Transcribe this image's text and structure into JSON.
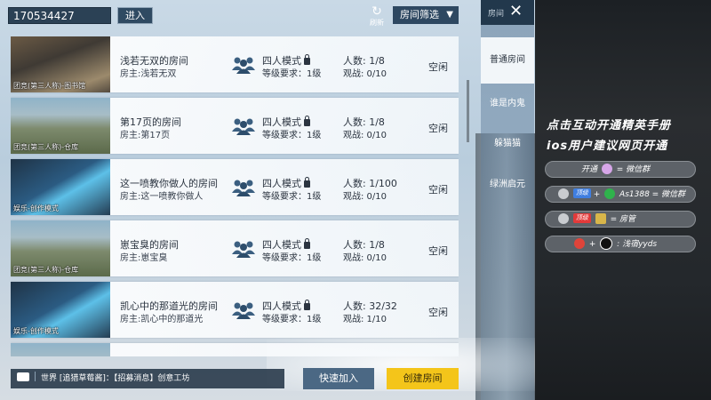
{
  "top_bar": {
    "room_id_value": "170534427",
    "enter_label": "进入",
    "refresh_label": "刷新",
    "filter_label": "房间筛选"
  },
  "rooms": [
    {
      "map_label": "团竞(第三人称)-图书馆",
      "name": "浅若无双的房间",
      "owner": "房主:浅若无双",
      "mode": "四人模式",
      "level_req": "等级要求：1级",
      "players": "人数: 1/8",
      "spectators": "观战: 0/10",
      "status": "空闲",
      "thumb": "library"
    },
    {
      "map_label": "团竞(第三人称)-仓库",
      "name": "第17页的房间",
      "owner": "房主:第17页",
      "mode": "四人模式",
      "level_req": "等级要求：1级",
      "players": "人数: 1/8",
      "spectators": "观战: 0/10",
      "status": "空闲",
      "thumb": "warehouse"
    },
    {
      "map_label": "娱乐-创作模式",
      "name": "这一喷教你做人的房间",
      "owner": "房主:这一喷教你做人",
      "mode": "四人模式",
      "level_req": "等级要求：1级",
      "players": "人数: 1/100",
      "spectators": "观战: 0/10",
      "status": "空闲",
      "thumb": "creative"
    },
    {
      "map_label": "团竞(第三人称)-仓库",
      "name": "崽宝臭的房间",
      "owner": "房主:崽宝臭",
      "mode": "四人模式",
      "level_req": "等级要求：1级",
      "players": "人数: 1/8",
      "spectators": "观战: 0/10",
      "status": "空闲",
      "thumb": "warehouse"
    },
    {
      "map_label": "娱乐-创作模式",
      "name": "凯心中的那道光的房间",
      "owner": "房主:凯心中的那道光",
      "mode": "四人模式",
      "level_req": "等级要求：1级",
      "players": "人数: 32/32",
      "spectators": "观战: 1/10",
      "status": "空闲",
      "thumb": "creative"
    }
  ],
  "bottom_bar": {
    "chat_channel": "世界",
    "chat_message": "[追猎草莓酱]：【招募消息】创意工坊",
    "quick_join_label": "快速加入",
    "create_room_label": "创建房间"
  },
  "tabs": {
    "header": "房间",
    "items": [
      "普通房间",
      "谁是内鬼",
      "躲猫猫",
      "绿洲启元"
    ],
    "active_index": 0
  },
  "promo": {
    "line1": "点击互动开通精英手册",
    "line2": "ios用户建议网页开通",
    "pill1_a": "开通",
    "pill1_b": "= 微信群",
    "pill2_tag": "顶级",
    "pill2_b": "+",
    "pill2_c": "As1388 = 微信群",
    "pill3_tag": "顶级",
    "pill3_b": "=  房管",
    "pill4_b": ":  浅宿yyds"
  },
  "colors": {
    "create_button": "#f4c51a",
    "quick_button": "#4b6884",
    "panel_dark": "#2b4155"
  }
}
